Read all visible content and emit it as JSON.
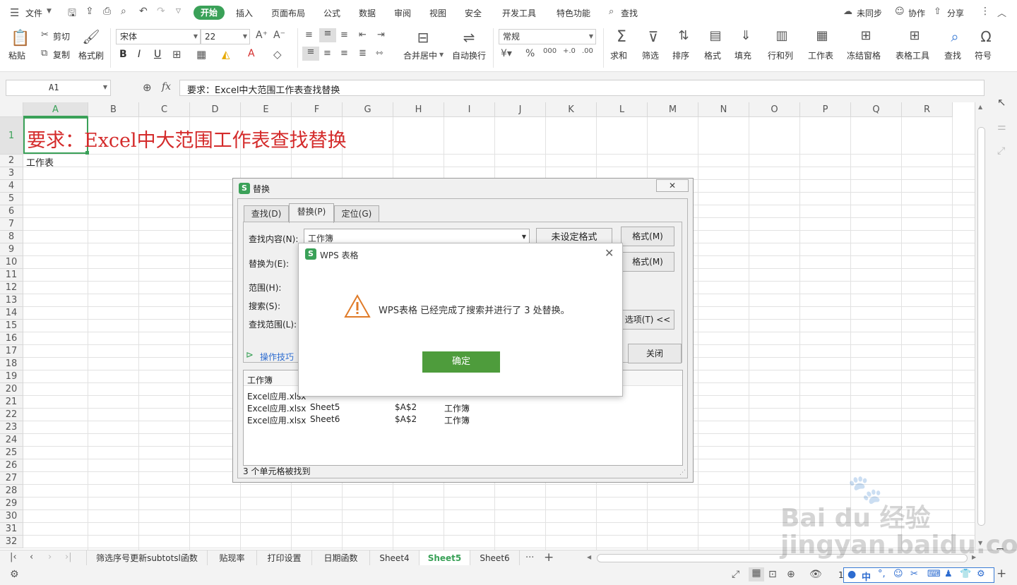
{
  "menubar": {
    "file": "文件",
    "tabs": [
      "开始",
      "插入",
      "页面布局",
      "公式",
      "数据",
      "审阅",
      "视图",
      "安全",
      "开发工具",
      "特色功能"
    ],
    "search": "查找",
    "sync": "未同步",
    "collab": "协作",
    "share": "分享"
  },
  "ribbon": {
    "paste": "粘贴",
    "cut": "剪切",
    "copy": "复制",
    "format_painter": "格式刷",
    "font_name": "宋体",
    "font_size": "22",
    "merge": "合并居中",
    "wrap": "自动换行",
    "number_format": "常规",
    "sum": "求和",
    "filter": "筛选",
    "sort": "排序",
    "format": "格式",
    "fill": "填充",
    "rowcol": "行和列",
    "worksheet": "工作表",
    "freeze": "冻结窗格",
    "table_tools": "表格工具",
    "find": "查找",
    "symbol": "符号"
  },
  "formula": {
    "cell_ref": "A1",
    "fx": "fx",
    "content": "要求：Excel中大范围工作表查找替换"
  },
  "grid": {
    "columns": [
      "A",
      "B",
      "C",
      "D",
      "E",
      "F",
      "G",
      "H",
      "I",
      "J",
      "K",
      "L",
      "M",
      "N",
      "O",
      "P",
      "Q",
      "R"
    ],
    "rows": [
      "1",
      "2",
      "3",
      "4",
      "5",
      "6",
      "7",
      "8",
      "9",
      "10",
      "11",
      "12",
      "13",
      "14",
      "15",
      "16",
      "17",
      "18",
      "19",
      "20",
      "21",
      "22",
      "23",
      "24",
      "25",
      "26",
      "27",
      "28",
      "29",
      "30",
      "31",
      "32"
    ],
    "a1": "要求：Excel中大范围工作表查找替换",
    "a2": "工作表",
    "a1_color": "#d42b2b"
  },
  "sheet_tabs": [
    "筛选序号更新subtotsl函数",
    "贴现率",
    "打印设置",
    "日期函数",
    "Sheet4",
    "Sheet5",
    "Sheet6"
  ],
  "sheet_more": "···",
  "sheet_add": "+",
  "status": {
    "zoom": "1"
  },
  "replace_dialog": {
    "title": "替换",
    "tabs": [
      "查找(D)",
      "替换(P)",
      "定位(G)"
    ],
    "find_label": "查找内容(N):",
    "find_value": "工作簿",
    "no_format": "未设定格式",
    "format_btn": "格式(M)",
    "replace_label": "替换为(E):",
    "range_label": "范围(H):",
    "search_label": "搜索(S):",
    "lookin_label": "查找范围(L):",
    "options_btn": "选项(T) <<",
    "tips": "操作技巧",
    "close_btn": "关闭",
    "result_header": "工作簿",
    "results": [
      {
        "book": "Excel应用.xlsx",
        "sheet": "",
        "cell": "",
        "value": ""
      },
      {
        "book": "Excel应用.xlsx",
        "sheet": "Sheet5",
        "cell": "$A$2",
        "value": "工作簿"
      },
      {
        "book": "Excel应用.xlsx",
        "sheet": "Sheet6",
        "cell": "$A$2",
        "value": "工作簿"
      }
    ],
    "status": "3 个单元格被找到"
  },
  "message_box": {
    "title": "WPS 表格",
    "text": "WPS表格 已经完成了搜索并进行了 3 处替换。",
    "ok": "确定"
  },
  "colors": {
    "accent": "#3aa158",
    "ok_button": "#4e9c3c",
    "title_red": "#d42b2b"
  },
  "watermark": "Bai du 经验 jingyan.baidu.com"
}
